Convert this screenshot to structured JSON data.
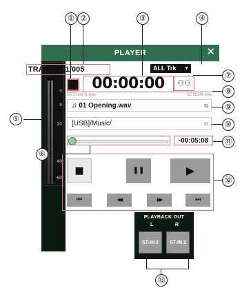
{
  "window": {
    "title": "PLAYER",
    "close_icon": "close-icon"
  },
  "track": {
    "label": "TRACK 001/005",
    "play_mode": "ALL Trk"
  },
  "timer": {
    "elapsed": "00:00:00",
    "prev_file": "05 Ending.wav",
    "next_file": "02 BGM.wav",
    "remaining": "-00:05:08"
  },
  "file": {
    "name": "♫ 01 Opening.wav",
    "folder": "[USB]/Music/"
  },
  "meter": {
    "ticks": [
      "3",
      "9",
      "20",
      "40",
      "60"
    ]
  },
  "transport": {
    "stop": "■",
    "pause": "❚❚",
    "play": "▶",
    "skip_back": "⏮",
    "rewind": "◀◀",
    "fast_forward": "▶▶",
    "skip_forward": "⏭"
  },
  "playback_out": {
    "title": "PLAYBACK OUT",
    "left_label": "L",
    "right_label": "R",
    "left_value": "ST-IN 2",
    "right_value": "ST-IN 2"
  },
  "seek": {
    "position_fraction": 0.0
  },
  "callouts": [
    "①",
    "②",
    "③",
    "④",
    "⑤",
    "⑥",
    "⑦",
    "⑧",
    "⑨",
    "⑩",
    "⑪",
    "⑫",
    "⑬"
  ],
  "colors": {
    "titlebar": "#2f6f4d",
    "highlight": "#e07080",
    "panel": "#0d1a12",
    "seek_knob": "#8fc99f"
  }
}
